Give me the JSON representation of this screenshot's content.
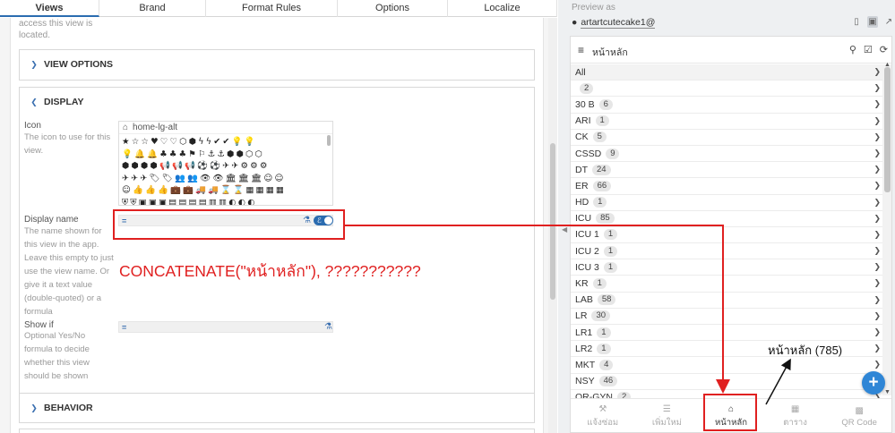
{
  "tabs": [
    {
      "label": "Views",
      "active": true
    },
    {
      "label": "Brand",
      "active": false
    },
    {
      "label": "Format Rules",
      "active": false
    },
    {
      "label": "Options",
      "active": false
    },
    {
      "label": "Localize",
      "active": false
    }
  ],
  "editor": {
    "top_help_text": "access this view is located.",
    "view_options": {
      "label": "VIEW OPTIONS",
      "icon": "chevron-down-icon"
    },
    "display": {
      "label": "DISPLAY",
      "icon": "chevron-up-icon",
      "icon_field": {
        "label": "Icon",
        "help": "The icon to use for this view.",
        "search_value": "home-lg-alt",
        "glyph_rows": [
          "★☆☆♥♡♡⬡⬢ϟϟ✔✔💡💡",
          "💡🔔🔔♣♣♣⚑⚐⚓⚓⬢⬢⬡⬡",
          "⬢⬢⬢⬢📢📢📢⚽⚽✈✈⚙⚙⚙",
          "✈✈✈🏷🏷👥👥👁👁🏛🏛🏛☺☺",
          "☺👍👍👍💼💼🚚🚚⌛⌛▦▦▦▦",
          "⛨⛨▣▣▣▤▤▤▤▥▥◐◐◐"
        ]
      },
      "display_name": {
        "label": "Display name",
        "help": "The name shown for this view in the app. Leave this empty to just use the view name. Or give it a text value (double-quoted) or a formula",
        "expr_symbol": "=",
        "value": ""
      },
      "show_if": {
        "label": "Show if",
        "help": "Optional Yes/No formula to decide whether this view should be shown",
        "expr_symbol": "=",
        "value": ""
      }
    },
    "behavior": {
      "label": "BEHAVIOR",
      "icon": "chevron-down-icon"
    },
    "annotation": "CONCATENATE(\"หน้าหลัก\"), ???????????"
  },
  "preview": {
    "preview_as_label": "Preview as",
    "user": "artartcutecake1@",
    "app_title": "หน้าหลัก",
    "rows": [
      {
        "name": "All",
        "count": ""
      },
      {
        "name": "",
        "count": "2"
      },
      {
        "name": "30 B",
        "count": "6"
      },
      {
        "name": "ARI",
        "count": "1"
      },
      {
        "name": "CK",
        "count": "5"
      },
      {
        "name": "CSSD",
        "count": "9"
      },
      {
        "name": "DT",
        "count": "24"
      },
      {
        "name": "ER",
        "count": "66"
      },
      {
        "name": "HD",
        "count": "1"
      },
      {
        "name": "ICU",
        "count": "85"
      },
      {
        "name": "ICU 1",
        "count": "1"
      },
      {
        "name": "ICU 2",
        "count": "1"
      },
      {
        "name": "ICU 3",
        "count": "1"
      },
      {
        "name": "KR",
        "count": "1"
      },
      {
        "name": "LAB",
        "count": "58"
      },
      {
        "name": "LR",
        "count": "30"
      },
      {
        "name": "LR1",
        "count": "1"
      },
      {
        "name": "LR2",
        "count": "1"
      },
      {
        "name": "MKT",
        "count": "4"
      },
      {
        "name": "NSY",
        "count": "46"
      },
      {
        "name": "OR-GYN",
        "count": "2"
      }
    ],
    "bottom_nav": [
      {
        "label": "แจ้งซ่อม",
        "icon": "tools-icon",
        "active": false
      },
      {
        "label": "เพิ่มใหม่",
        "icon": "list-icon",
        "active": false
      },
      {
        "label": "หน้าหลัก",
        "icon": "home-icon",
        "active": true
      },
      {
        "label": "ตาราง",
        "icon": "table-icon",
        "active": false
      },
      {
        "label": "QR Code",
        "icon": "qr-code-icon",
        "active": false
      }
    ],
    "fab": "+",
    "annotation": "หน้าหลัก (785)"
  },
  "colors": {
    "accent": "#2b6cb0",
    "annotation_red": "#e02020",
    "fab": "#2f86d6"
  }
}
